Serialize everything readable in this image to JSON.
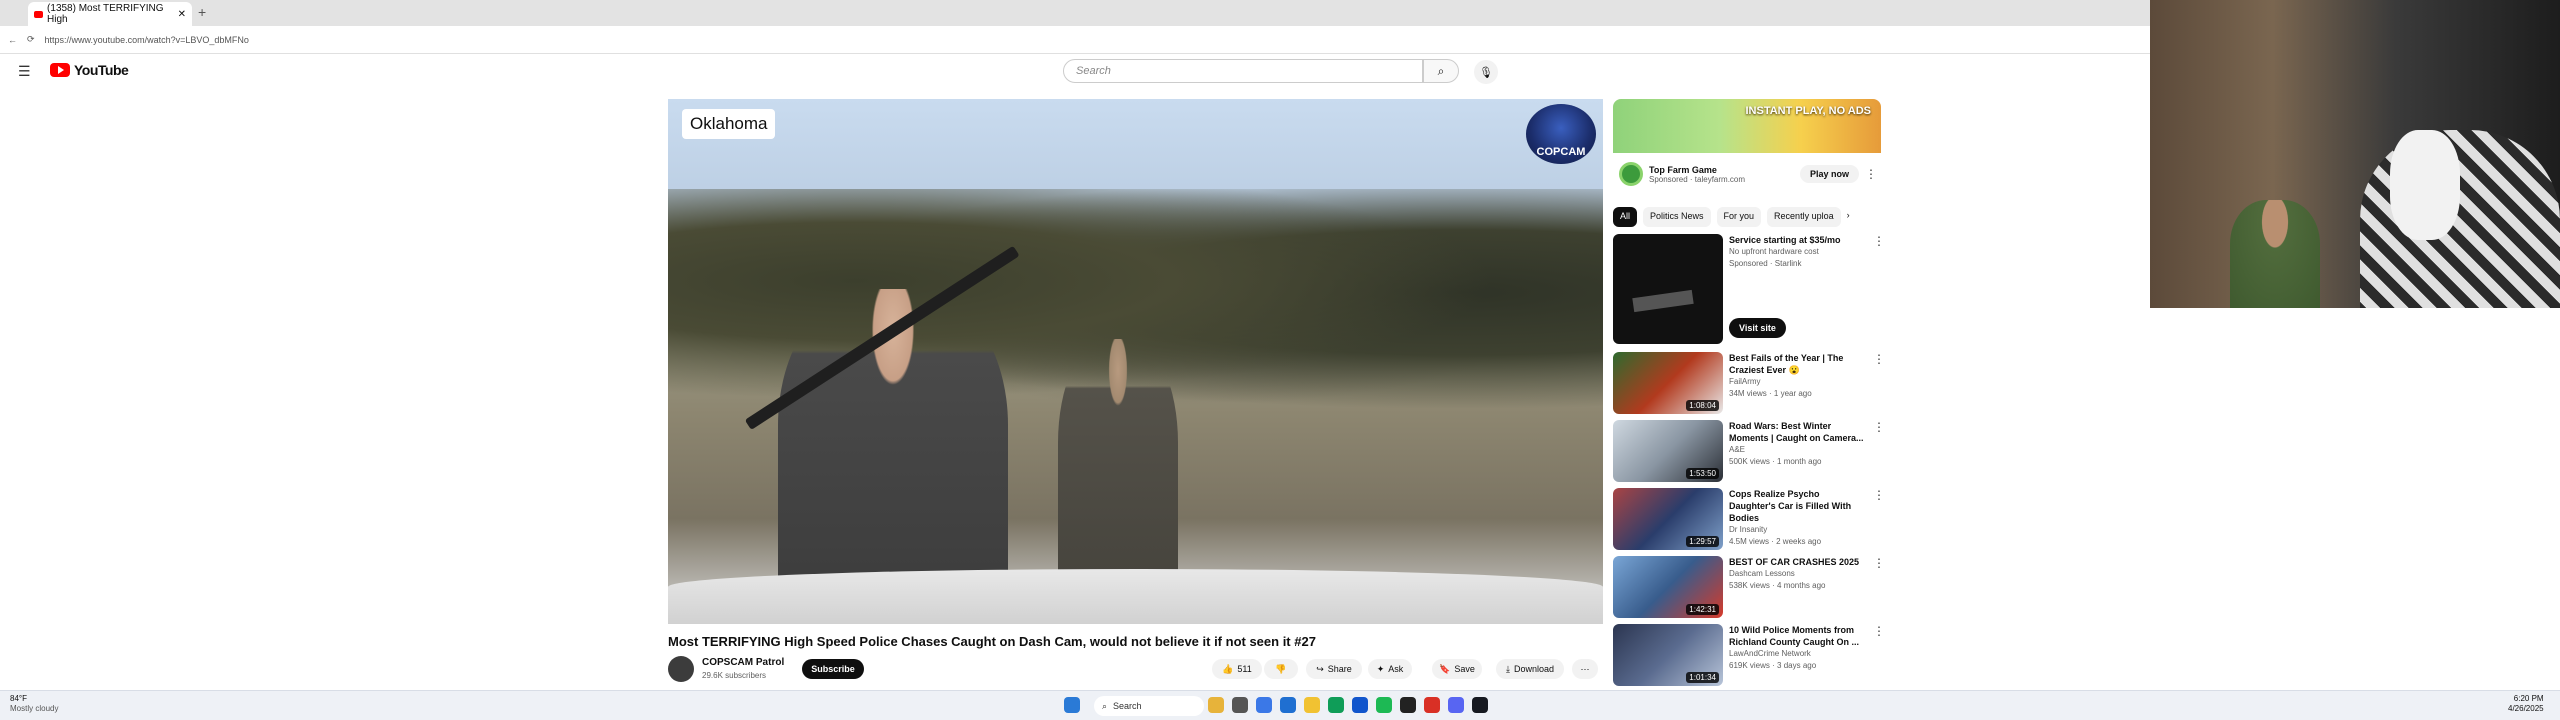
{
  "browser": {
    "tab_title": "(1358) Most TERRIFYING High",
    "new_tab": "+",
    "url": "https://www.youtube.com/watch?v=LBVO_dbMFNo"
  },
  "youtube": {
    "brand": "YouTube",
    "search_placeholder": "Search"
  },
  "video": {
    "location_label": "Oklahoma",
    "watermark": "COPCAM",
    "title": "Most TERRIFYING High Speed Police Chases Caught on Dash Cam, would not believe it if not seen it #27",
    "channel": "COPSCAM Patrol",
    "subscribers": "29.6K subscribers",
    "subscribe_label": "Subscribe",
    "likes": "511",
    "share_label": "Share",
    "ask_label": "Ask",
    "save_label": "Save",
    "download_label": "Download"
  },
  "ad": {
    "banner_text": "INSTANT PLAY, NO ADS",
    "title": "Top Farm Game",
    "sponsor": "Sponsored · taleyfarm.com",
    "cta": "Play now"
  },
  "chips": [
    "All",
    "Politics News",
    "For you",
    "Recently uploa"
  ],
  "recommendations": [
    {
      "title": "Service starting at $35/mo",
      "channel": "No upfront hardware cost",
      "meta": "Sponsored · Starlink",
      "cta": "Visit site",
      "duration": ""
    },
    {
      "title": "Best Fails of the Year | The Craziest Ever 😮",
      "channel": "FailArmy",
      "meta": "34M views · 1 year ago",
      "duration": "1:08:04"
    },
    {
      "title": "Road Wars: Best Winter Moments | Caught on Camera...",
      "channel": "A&E",
      "meta": "500K views · 1 month ago",
      "duration": "1:53:50"
    },
    {
      "title": "Cops Realize Psycho Daughter's Car is Filled With Bodies",
      "channel": "Dr Insanity",
      "meta": "4.5M views · 2 weeks ago",
      "duration": "1:29:57"
    },
    {
      "title": "BEST OF CAR CRASHES 2025",
      "channel": "Dashcam Lessons",
      "meta": "538K views · 4 months ago",
      "duration": "1:42:31"
    },
    {
      "title": "10 Wild Police Moments from Richland County Caught On ...",
      "channel": "LawAndCrime Network",
      "meta": "619K views · 3 days ago",
      "duration": "1:01:34"
    }
  ],
  "taskbar": {
    "temperature": "84°F",
    "weather": "Mostly cloudy",
    "search": "Search",
    "time": "6:20 PM",
    "date": "4/26/2025"
  }
}
